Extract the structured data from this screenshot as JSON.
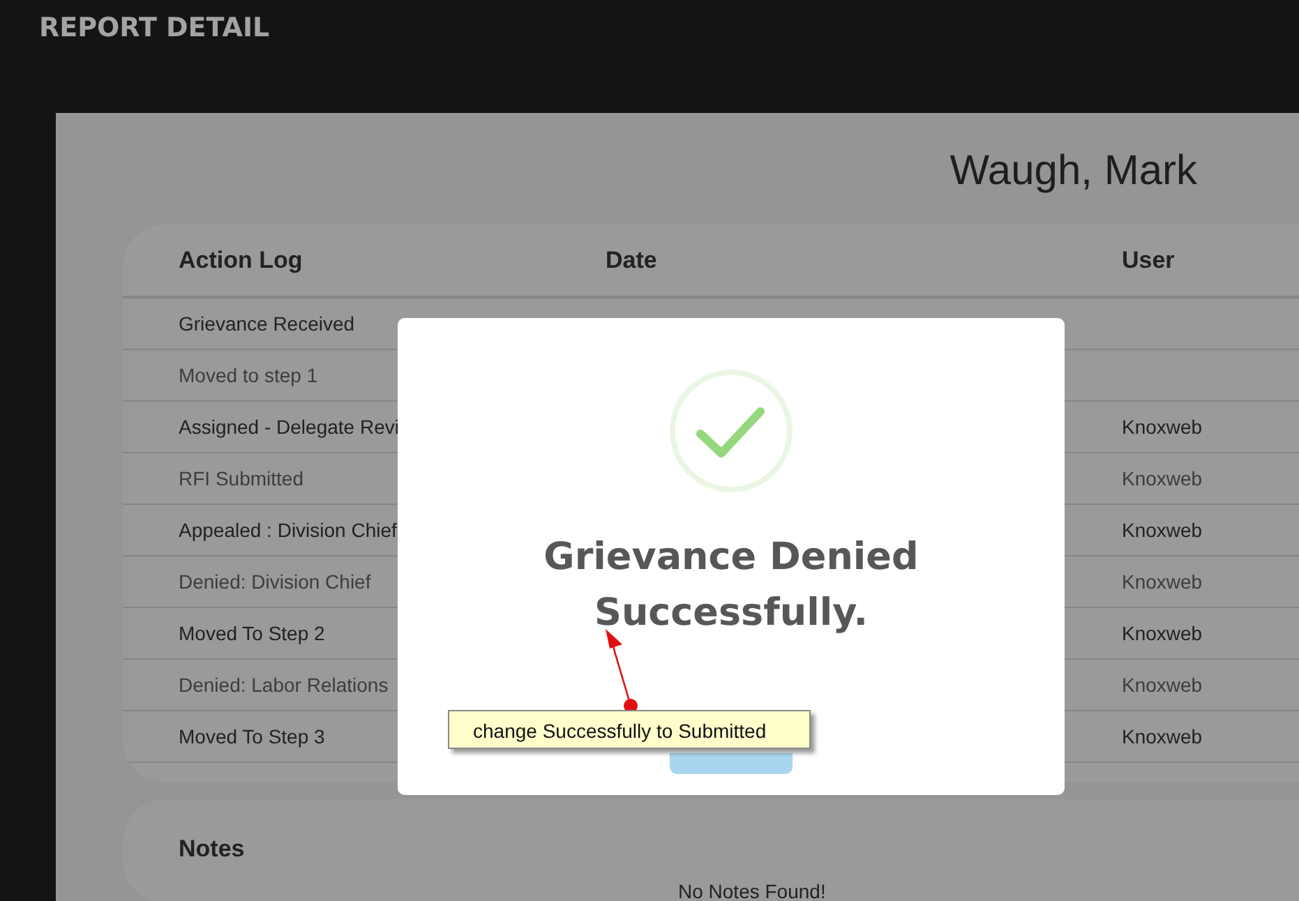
{
  "header": {
    "title": "REPORT DETAIL"
  },
  "person": {
    "name": "Waugh, Mark"
  },
  "action_log": {
    "columns": [
      "Action Log",
      "Date",
      "User"
    ],
    "rows": [
      {
        "action": "Grievance Received",
        "user": ""
      },
      {
        "action": "Moved to step 1",
        "user": ""
      },
      {
        "action": "Assigned - Delegate Revi",
        "user": "Knoxweb"
      },
      {
        "action": "RFI Submitted",
        "user": "Knoxweb"
      },
      {
        "action": "Appealed : Division Chief",
        "user": "Knoxweb"
      },
      {
        "action": "Denied: Division Chief",
        "user": "Knoxweb"
      },
      {
        "action": "Moved To Step 2",
        "user": "Knoxweb"
      },
      {
        "action": "Denied: Labor Relations",
        "user": "Knoxweb"
      },
      {
        "action": "Moved To Step 3",
        "user": "Knoxweb"
      }
    ]
  },
  "notes": {
    "title": "Notes",
    "empty_message": "No Notes Found!"
  },
  "dialog": {
    "message": "Grievance Denied Successfully."
  },
  "annotation": {
    "text": "change Successfully to Submitted"
  }
}
